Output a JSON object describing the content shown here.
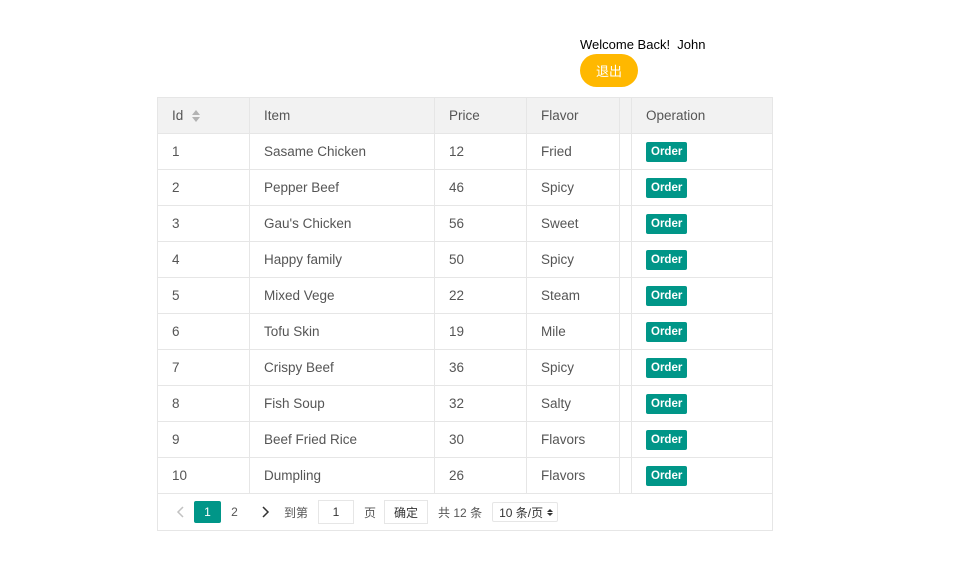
{
  "header": {
    "welcome_text": "Welcome Back!  John",
    "logout_label": "退出"
  },
  "colors": {
    "logout_button": "#FFB800",
    "order_button": "#009688",
    "active_page": "#009688"
  },
  "table": {
    "columns": [
      "Id",
      "Item",
      "Price",
      "Flavor",
      "",
      "Operation"
    ],
    "rows": [
      {
        "id": "1",
        "item": "Sasame Chicken",
        "price": "12",
        "flavor": "Fried",
        "action": "Order"
      },
      {
        "id": "2",
        "item": "Pepper Beef",
        "price": "46",
        "flavor": "Spicy",
        "action": "Order"
      },
      {
        "id": "3",
        "item": "Gau's Chicken",
        "price": "56",
        "flavor": "Sweet",
        "action": "Order"
      },
      {
        "id": "4",
        "item": "Happy family",
        "price": "50",
        "flavor": "Spicy",
        "action": "Order"
      },
      {
        "id": "5",
        "item": "Mixed Vege",
        "price": "22",
        "flavor": "Steam",
        "action": "Order"
      },
      {
        "id": "6",
        "item": "Tofu Skin",
        "price": "19",
        "flavor": "Mile",
        "action": "Order"
      },
      {
        "id": "7",
        "item": "Crispy Beef",
        "price": "36",
        "flavor": "Spicy",
        "action": "Order"
      },
      {
        "id": "8",
        "item": "Fish Soup",
        "price": "32",
        "flavor": "Salty",
        "action": "Order"
      },
      {
        "id": "9",
        "item": "Beef Fried Rice",
        "price": "30",
        "flavor": "Flavors",
        "action": "Order"
      },
      {
        "id": "10",
        "item": "Dumpling",
        "price": "26",
        "flavor": "Flavors",
        "action": "Order"
      }
    ]
  },
  "pager": {
    "pages": [
      "1",
      "2"
    ],
    "current_page": "1",
    "goto_label": "到第",
    "goto_value": "1",
    "page_label": "页",
    "confirm_label": "确定",
    "total_label": "共 12 条",
    "page_size_label": "10 条/页",
    "prev_icon": "chevron-left-icon",
    "next_icon": "chevron-right-icon"
  }
}
